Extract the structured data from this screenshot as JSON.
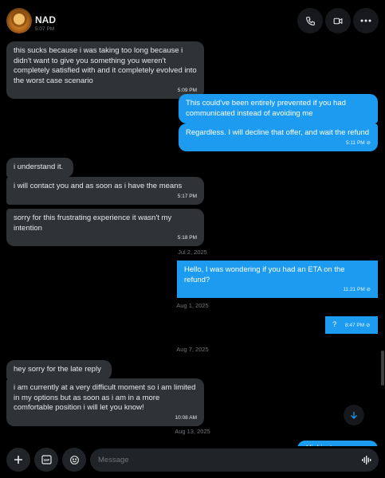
{
  "header": {
    "name": "NAD",
    "status": "5:07 PM",
    "icons": [
      "phone-icon",
      "video-icon",
      "more-icon"
    ]
  },
  "messages": {
    "m1": {
      "text": "this sucks because i was taking too long because i didn't want to give you something you weren't completely satisfied with and it completely evolved into the worst case scenario",
      "time": "5:09 PM"
    },
    "m2": {
      "text": "This could've been entirely prevented if you had communicated instead of avoiding me"
    },
    "m3": {
      "text": "Regardless. I will decline that offer, and wait the refund",
      "time": "5:11 PM"
    },
    "m4": {
      "text": "i understand it."
    },
    "m5": {
      "text": "i will contact you and as soon as i have the means",
      "time": "5:17 PM"
    },
    "m6": {
      "text": "sorry for this frustrating experience it wasn't my intention",
      "time": "5:18 PM"
    },
    "m7": {
      "text": "Hello, I was wondering if you had an ETA on the refund?",
      "time": "11:21 PM"
    },
    "m8": {
      "text": "?",
      "time": "8:47 PM"
    },
    "m9": {
      "text": "hey sorry for the late reply"
    },
    "m10": {
      "text": "i am currently at a very difficult moment so i am limited in my options but as soon as i am in a more comfortable position i will let you know!",
      "time": "10:08 AM"
    },
    "m11": {
      "text": "Hi, I just"
    }
  },
  "dates": {
    "d1": "Jul 2, 2025",
    "d2": "Aug 1, 2025",
    "d3": "Aug 7, 2025",
    "d4": "Aug 13, 2025"
  },
  "composer": {
    "placeholder": "Message",
    "icons": [
      "plus-icon",
      "gif-icon",
      "emoji-icon",
      "voice-icon"
    ]
  },
  "colors": {
    "outgoing": "#1d9bf0",
    "incoming": "#2f3336",
    "background": "#000000"
  }
}
